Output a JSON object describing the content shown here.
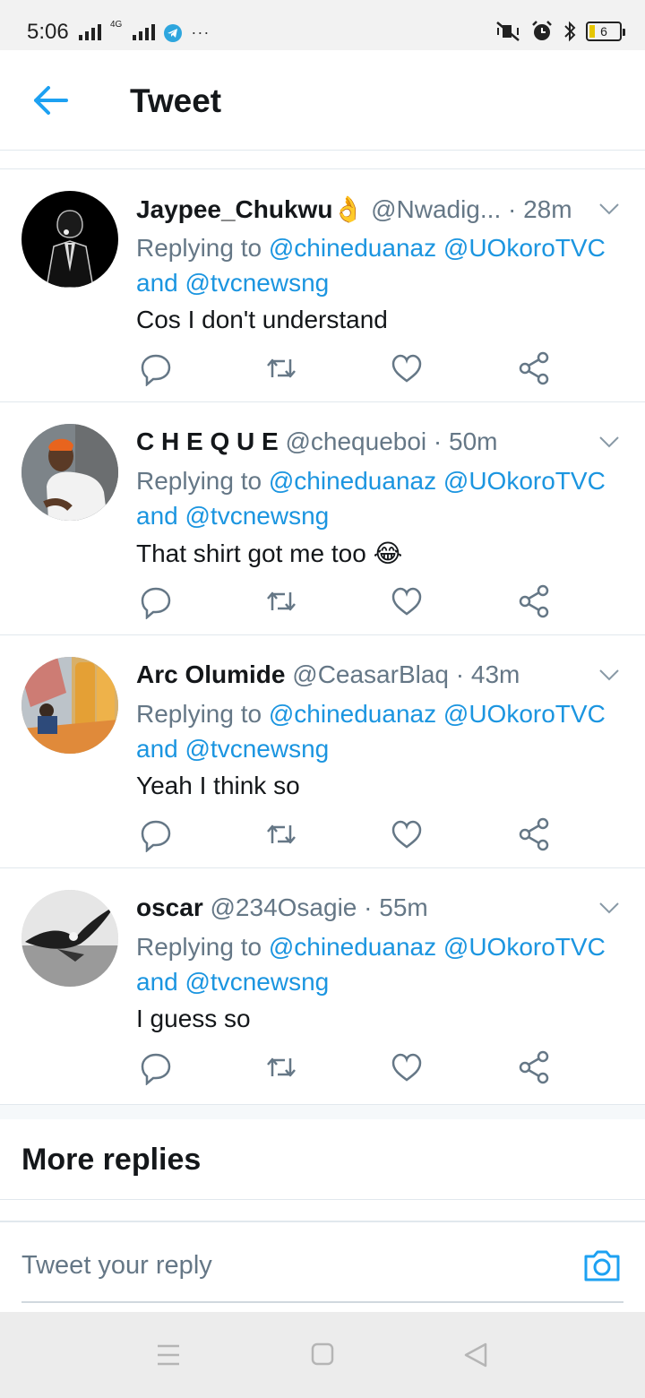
{
  "status_bar": {
    "time": "5:06",
    "network": "4G",
    "battery": "6",
    "more": "···"
  },
  "header": {
    "title": "Tweet"
  },
  "tweets": [
    {
      "name": "Jaypee_Chukwu👌",
      "handle": "@Nwadig...",
      "time": "· 28m",
      "replying_label": "Replying to",
      "mention_1": "@chineduanaz",
      "mention_2": "@UOkoroTVC",
      "and_label": "and",
      "mention_3": "@tvcnewsng",
      "text": "Cos I don't understand"
    },
    {
      "name": "C H E Q U E",
      "handle": "@chequeboi",
      "time": "· 50m",
      "replying_label": "Replying to",
      "mention_1": "@chineduanaz",
      "mention_2": "@UOkoroTVC",
      "and_label": "and",
      "mention_3": "@tvcnewsng",
      "text": "That shirt got me too 😂"
    },
    {
      "name": "Arc Olumide",
      "handle": "@CeasarBlaq",
      "time": "· 43m",
      "replying_label": "Replying to",
      "mention_1": "@chineduanaz",
      "mention_2": "@UOkoroTVC",
      "and_label": "and",
      "mention_3": "@tvcnewsng",
      "text": "Yeah I think so"
    },
    {
      "name": "oscar",
      "handle": "@234Osagie",
      "time": "· 55m",
      "replying_label": "Replying to",
      "mention_1": "@chineduanaz",
      "mention_2": "@UOkoroTVC",
      "and_label": "and",
      "mention_3": "@tvcnewsng",
      "text": "I guess so"
    }
  ],
  "more_replies": {
    "title": "More replies"
  },
  "compose": {
    "placeholder": "Tweet your reply"
  },
  "icons": {
    "back": "arrow-left-icon",
    "reply": "reply-icon",
    "retweet": "retweet-icon",
    "like": "heart-icon",
    "share": "share-icon",
    "camera": "camera-icon",
    "menu": "menu-icon",
    "home": "home-square-icon",
    "back_nav": "back-triangle-icon"
  },
  "colors": {
    "accent": "#1da1f2",
    "mention": "#1b95e0",
    "secondary_text": "#657786",
    "primary_text": "#14171a",
    "divider": "#e1e8ed"
  }
}
